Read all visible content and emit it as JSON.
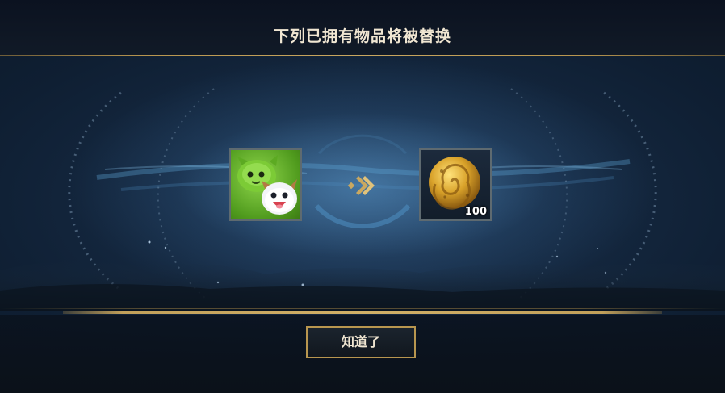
{
  "dialog": {
    "title": "下列已拥有物品将被替换",
    "confirm_label": "知道了"
  },
  "replacement": {
    "old_item": {
      "icon": "poro-icon-green"
    },
    "arrow_icon": "double-chevron-right-icon",
    "new_item": {
      "icon": "gold-coin-icon",
      "quantity": "100"
    }
  },
  "colors": {
    "accent_gold": "#c2a05a",
    "title_text": "#f0e6d2",
    "background": "#0f1f33"
  }
}
